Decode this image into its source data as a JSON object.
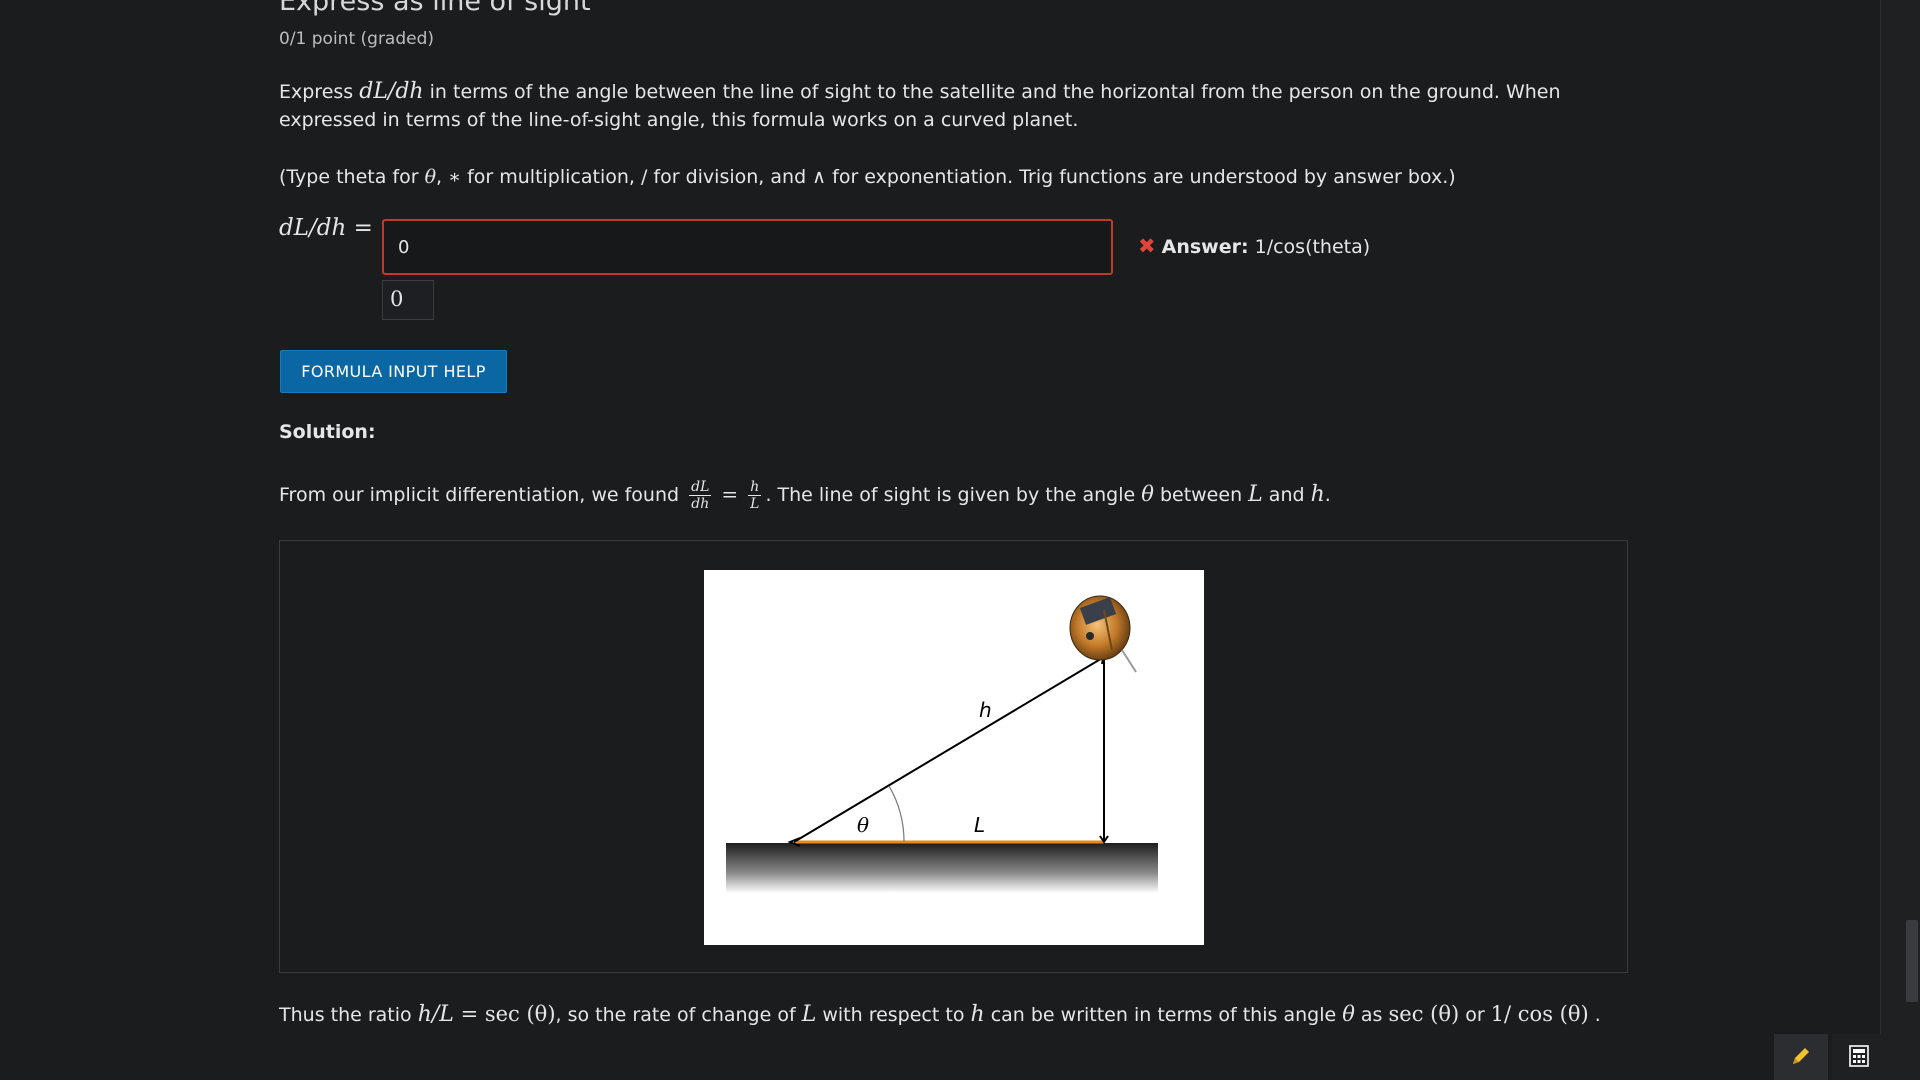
{
  "problem": {
    "heading": "Express as line of sight",
    "points": "0/1 point (graded)",
    "prompt_pre": "Express ",
    "prompt_math": "dL/dh",
    "prompt_post": " in terms of the angle between the line of sight to the satellite and the horizontal from the person on the ground. When expressed in terms of the line-of-sight angle, this formula works on a curved planet.",
    "instructions_1": "(Type theta for ",
    "instructions_theta": "θ",
    "instructions_2": ", ",
    "instructions_star": "∗",
    "instructions_3": " for multiplication, / for division, and ",
    "instructions_wedge": "∧",
    "instructions_4": " for exponentiation. Trig functions are understood by answer box.)"
  },
  "answer": {
    "lhs": "dL/dh =",
    "input_value": "0",
    "preview_value": "0",
    "status_icon": "✖",
    "status_label": "Answer:",
    "status_value": "1/cos(theta)",
    "help_button": "FORMULA INPUT HELP"
  },
  "solution": {
    "label": "Solution:",
    "line1_pre": "From our implicit differentiation, we found ",
    "frac1_num": "dL",
    "frac1_den": "dh",
    "equals": "=",
    "frac2_num": "h",
    "frac2_den": "L",
    "line1_mid": ". The line of sight is given by the angle ",
    "theta": "θ",
    "line1_between": " between ",
    "L": "L",
    "and": " and ",
    "h": "h",
    "period": ".",
    "line2_pre": "Thus the ratio ",
    "line2_ratio": "h/L",
    "line2_eq": " = sec (θ)",
    "line2_mid1": ", so the rate of change of ",
    "line2_mid2": " with respect to ",
    "line2_mid3": " can be written in terms of this angle ",
    "line2_mid4": " as ",
    "line2_sec": "sec (θ)",
    "line2_or": " or ",
    "line2_recip": "1/ cos (θ)",
    "line2_end": " ."
  },
  "figure": {
    "label_h": "h",
    "label_L": "L",
    "label_theta": "θ",
    "colors": {
      "orange": "#e8891d",
      "ground_top": "#222222"
    }
  },
  "toolbar": {
    "edit_icon": "pencil-icon",
    "calc_icon": "calculator-icon"
  }
}
